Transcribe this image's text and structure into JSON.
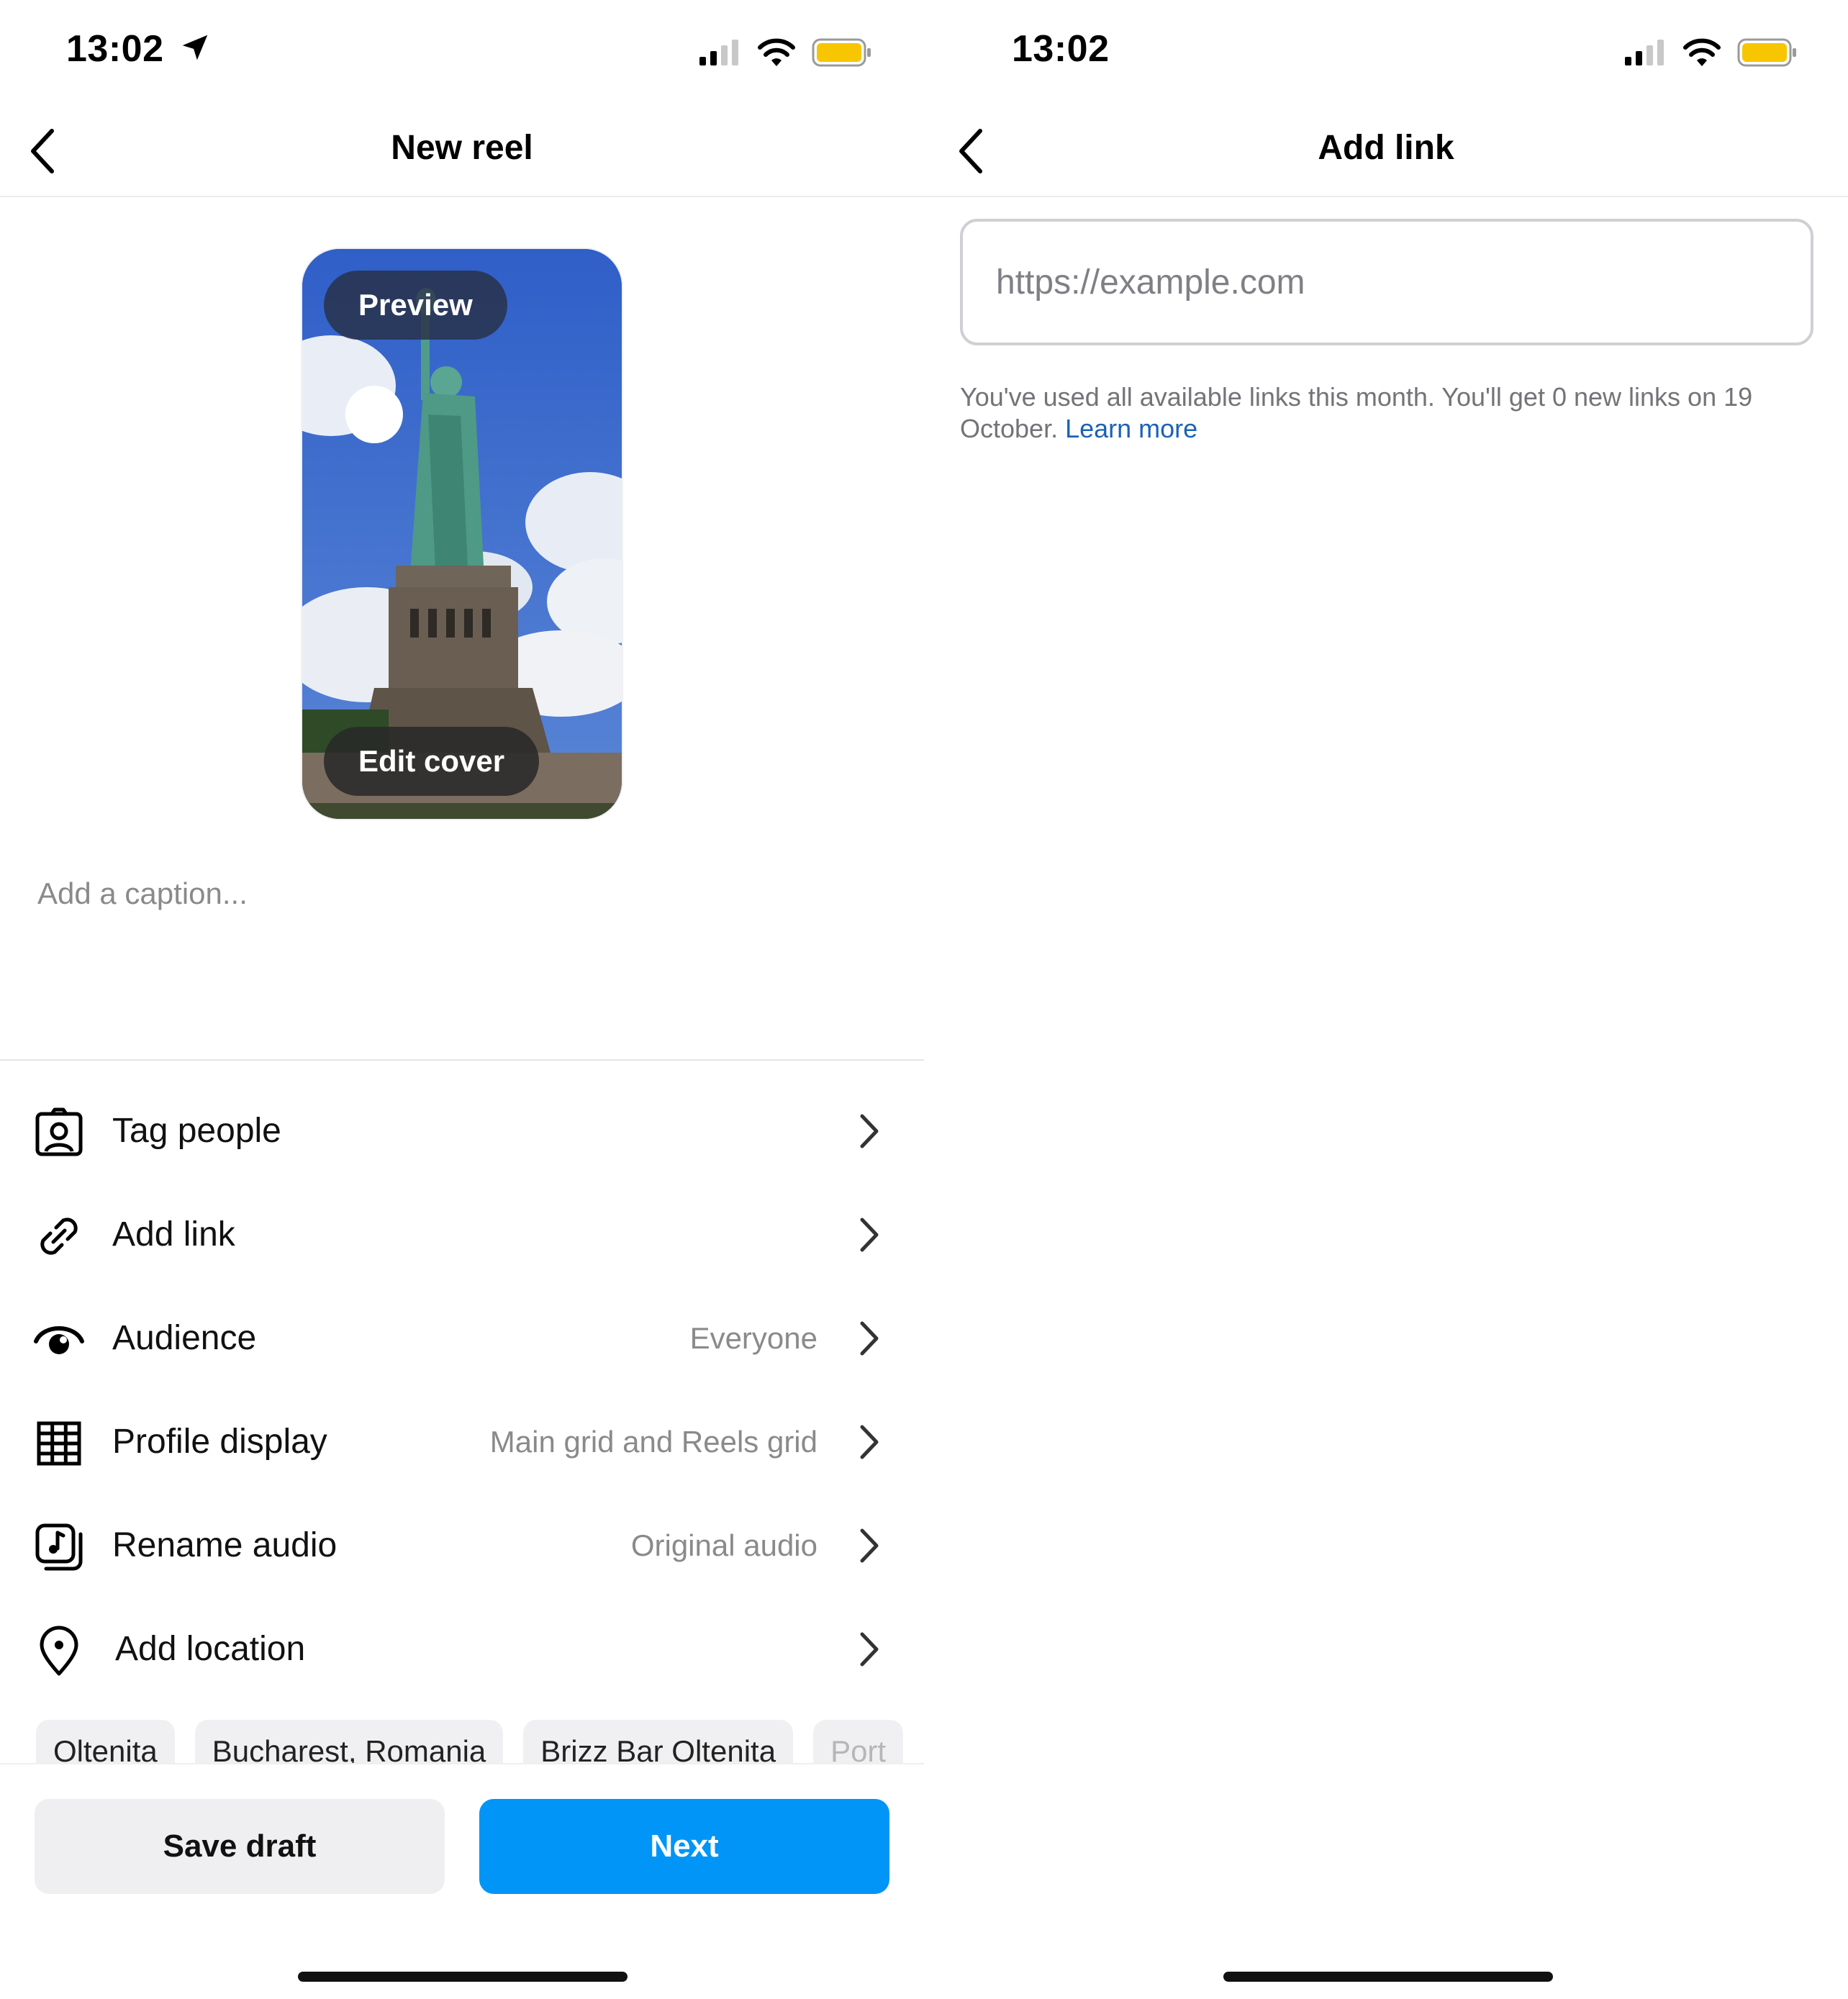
{
  "left_screen": {
    "status": {
      "time": "13:02"
    },
    "nav": {
      "title": "New reel"
    },
    "cover": {
      "preview_label": "Preview",
      "edit_cover_label": "Edit cover"
    },
    "caption_placeholder": "Add a caption...",
    "options": [
      {
        "label": "Tag people",
        "value": "",
        "icon": "tag-people-icon"
      },
      {
        "label": "Add link",
        "value": "",
        "icon": "link-icon"
      },
      {
        "label": "Audience",
        "value": "Everyone",
        "icon": "audience-eye-icon"
      },
      {
        "label": "Profile display",
        "value": "Main grid and Reels grid",
        "icon": "grid-icon"
      },
      {
        "label": "Rename audio",
        "value": "Original audio",
        "icon": "audio-icon"
      },
      {
        "label": "Add location",
        "value": "",
        "icon": "location-pin-icon"
      }
    ],
    "location_chips": [
      "Oltenita",
      "Bucharest, Romania",
      "Brizz Bar Oltenita",
      "Port"
    ],
    "buttons": {
      "save_draft": "Save draft",
      "next": "Next"
    },
    "colors": {
      "primary": "#0095f6",
      "secondary_button": "#efeff2",
      "battery": "#f7c600"
    }
  },
  "right_screen": {
    "status": {
      "time": "13:02"
    },
    "nav": {
      "title": "Add link"
    },
    "url_field": {
      "placeholder": "https://example.com",
      "value": ""
    },
    "notice": {
      "text": "You've used all available links this month. You'll get 0 new links on 19 October.",
      "link": "Learn more"
    }
  }
}
